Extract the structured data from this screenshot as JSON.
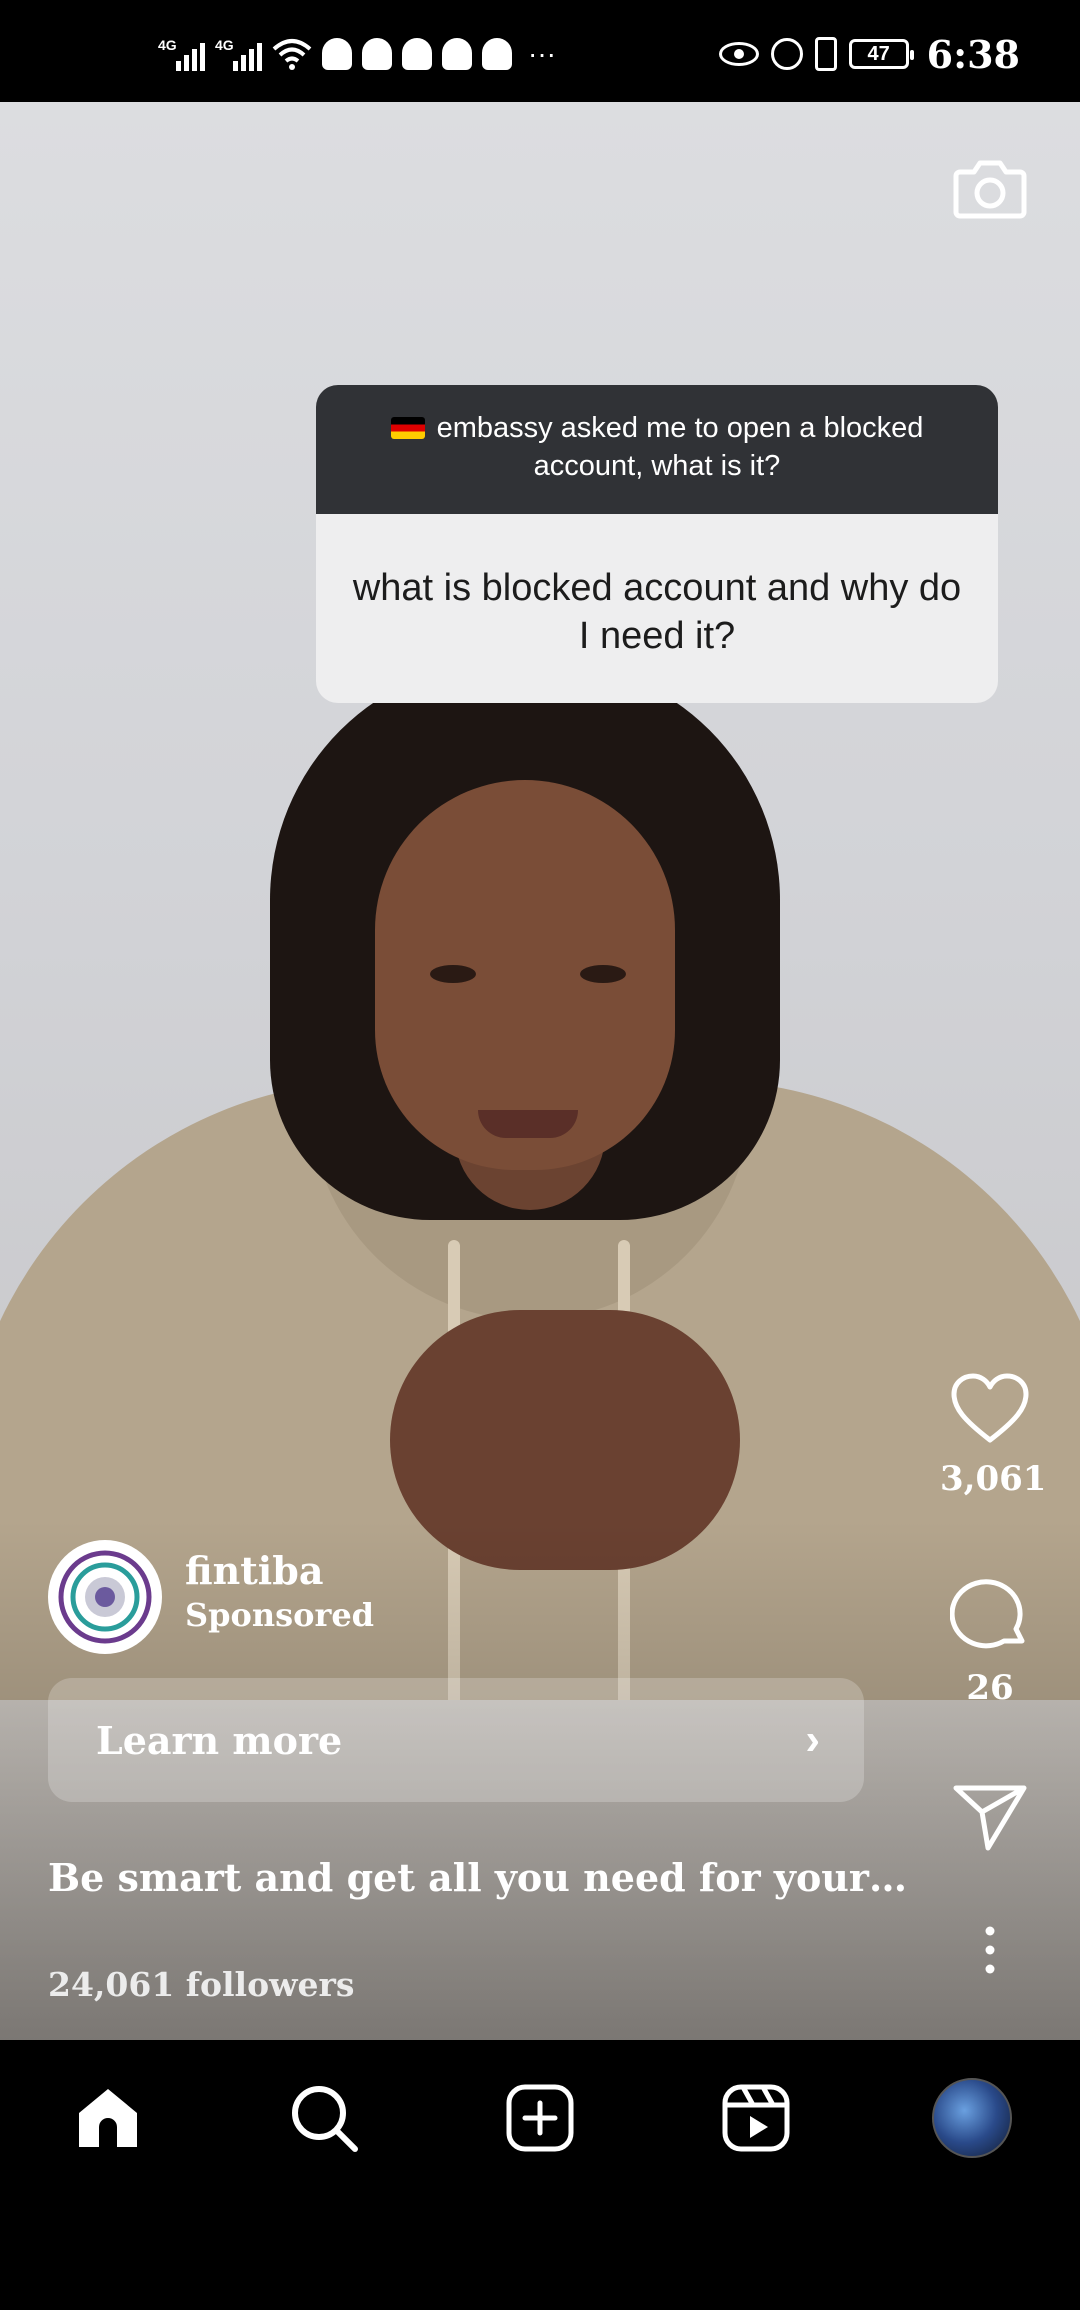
{
  "status_bar": {
    "network_1": "4G",
    "network_2": "4G",
    "more": "···",
    "battery": "47",
    "time": "6:38"
  },
  "sticker": {
    "question": "embassy asked me to open a blocked account, what is it?",
    "answer": "what is blocked account and why do I need it?"
  },
  "actions": {
    "likes": "3,061",
    "comments": "26"
  },
  "post": {
    "author": "fintiba",
    "sponsored": "Sponsored",
    "cta": "Learn more",
    "caption": "Be smart and get all you need for your ...",
    "followers": "24,061 followers"
  },
  "nav": {
    "items": [
      "home-icon",
      "search-icon",
      "create-icon",
      "reels-icon",
      "profile-avatar"
    ]
  },
  "colors": {
    "sticker_header": "#303236",
    "sticker_body": "#eeeeef",
    "background": "#000000"
  }
}
